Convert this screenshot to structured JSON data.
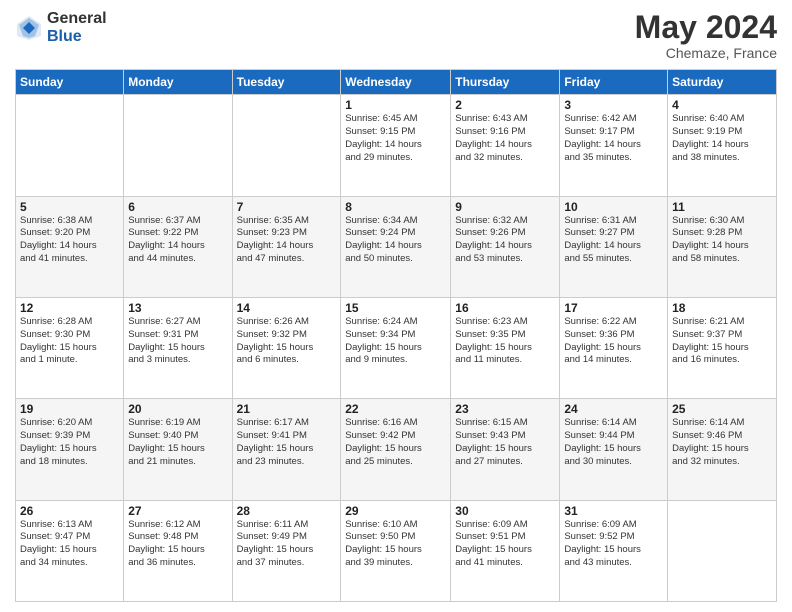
{
  "header": {
    "logo_general": "General",
    "logo_blue": "Blue",
    "main_title": "May 2024",
    "subtitle": "Chemaze, France"
  },
  "calendar": {
    "days_of_week": [
      "Sunday",
      "Monday",
      "Tuesday",
      "Wednesday",
      "Thursday",
      "Friday",
      "Saturday"
    ],
    "weeks": [
      [
        {
          "num": "",
          "info": ""
        },
        {
          "num": "",
          "info": ""
        },
        {
          "num": "",
          "info": ""
        },
        {
          "num": "1",
          "info": "Sunrise: 6:45 AM\nSunset: 9:15 PM\nDaylight: 14 hours\nand 29 minutes."
        },
        {
          "num": "2",
          "info": "Sunrise: 6:43 AM\nSunset: 9:16 PM\nDaylight: 14 hours\nand 32 minutes."
        },
        {
          "num": "3",
          "info": "Sunrise: 6:42 AM\nSunset: 9:17 PM\nDaylight: 14 hours\nand 35 minutes."
        },
        {
          "num": "4",
          "info": "Sunrise: 6:40 AM\nSunset: 9:19 PM\nDaylight: 14 hours\nand 38 minutes."
        }
      ],
      [
        {
          "num": "5",
          "info": "Sunrise: 6:38 AM\nSunset: 9:20 PM\nDaylight: 14 hours\nand 41 minutes."
        },
        {
          "num": "6",
          "info": "Sunrise: 6:37 AM\nSunset: 9:22 PM\nDaylight: 14 hours\nand 44 minutes."
        },
        {
          "num": "7",
          "info": "Sunrise: 6:35 AM\nSunset: 9:23 PM\nDaylight: 14 hours\nand 47 minutes."
        },
        {
          "num": "8",
          "info": "Sunrise: 6:34 AM\nSunset: 9:24 PM\nDaylight: 14 hours\nand 50 minutes."
        },
        {
          "num": "9",
          "info": "Sunrise: 6:32 AM\nSunset: 9:26 PM\nDaylight: 14 hours\nand 53 minutes."
        },
        {
          "num": "10",
          "info": "Sunrise: 6:31 AM\nSunset: 9:27 PM\nDaylight: 14 hours\nand 55 minutes."
        },
        {
          "num": "11",
          "info": "Sunrise: 6:30 AM\nSunset: 9:28 PM\nDaylight: 14 hours\nand 58 minutes."
        }
      ],
      [
        {
          "num": "12",
          "info": "Sunrise: 6:28 AM\nSunset: 9:30 PM\nDaylight: 15 hours\nand 1 minute."
        },
        {
          "num": "13",
          "info": "Sunrise: 6:27 AM\nSunset: 9:31 PM\nDaylight: 15 hours\nand 3 minutes."
        },
        {
          "num": "14",
          "info": "Sunrise: 6:26 AM\nSunset: 9:32 PM\nDaylight: 15 hours\nand 6 minutes."
        },
        {
          "num": "15",
          "info": "Sunrise: 6:24 AM\nSunset: 9:34 PM\nDaylight: 15 hours\nand 9 minutes."
        },
        {
          "num": "16",
          "info": "Sunrise: 6:23 AM\nSunset: 9:35 PM\nDaylight: 15 hours\nand 11 minutes."
        },
        {
          "num": "17",
          "info": "Sunrise: 6:22 AM\nSunset: 9:36 PM\nDaylight: 15 hours\nand 14 minutes."
        },
        {
          "num": "18",
          "info": "Sunrise: 6:21 AM\nSunset: 9:37 PM\nDaylight: 15 hours\nand 16 minutes."
        }
      ],
      [
        {
          "num": "19",
          "info": "Sunrise: 6:20 AM\nSunset: 9:39 PM\nDaylight: 15 hours\nand 18 minutes."
        },
        {
          "num": "20",
          "info": "Sunrise: 6:19 AM\nSunset: 9:40 PM\nDaylight: 15 hours\nand 21 minutes."
        },
        {
          "num": "21",
          "info": "Sunrise: 6:17 AM\nSunset: 9:41 PM\nDaylight: 15 hours\nand 23 minutes."
        },
        {
          "num": "22",
          "info": "Sunrise: 6:16 AM\nSunset: 9:42 PM\nDaylight: 15 hours\nand 25 minutes."
        },
        {
          "num": "23",
          "info": "Sunrise: 6:15 AM\nSunset: 9:43 PM\nDaylight: 15 hours\nand 27 minutes."
        },
        {
          "num": "24",
          "info": "Sunrise: 6:14 AM\nSunset: 9:44 PM\nDaylight: 15 hours\nand 30 minutes."
        },
        {
          "num": "25",
          "info": "Sunrise: 6:14 AM\nSunset: 9:46 PM\nDaylight: 15 hours\nand 32 minutes."
        }
      ],
      [
        {
          "num": "26",
          "info": "Sunrise: 6:13 AM\nSunset: 9:47 PM\nDaylight: 15 hours\nand 34 minutes."
        },
        {
          "num": "27",
          "info": "Sunrise: 6:12 AM\nSunset: 9:48 PM\nDaylight: 15 hours\nand 36 minutes."
        },
        {
          "num": "28",
          "info": "Sunrise: 6:11 AM\nSunset: 9:49 PM\nDaylight: 15 hours\nand 37 minutes."
        },
        {
          "num": "29",
          "info": "Sunrise: 6:10 AM\nSunset: 9:50 PM\nDaylight: 15 hours\nand 39 minutes."
        },
        {
          "num": "30",
          "info": "Sunrise: 6:09 AM\nSunset: 9:51 PM\nDaylight: 15 hours\nand 41 minutes."
        },
        {
          "num": "31",
          "info": "Sunrise: 6:09 AM\nSunset: 9:52 PM\nDaylight: 15 hours\nand 43 minutes."
        },
        {
          "num": "",
          "info": ""
        }
      ]
    ]
  }
}
